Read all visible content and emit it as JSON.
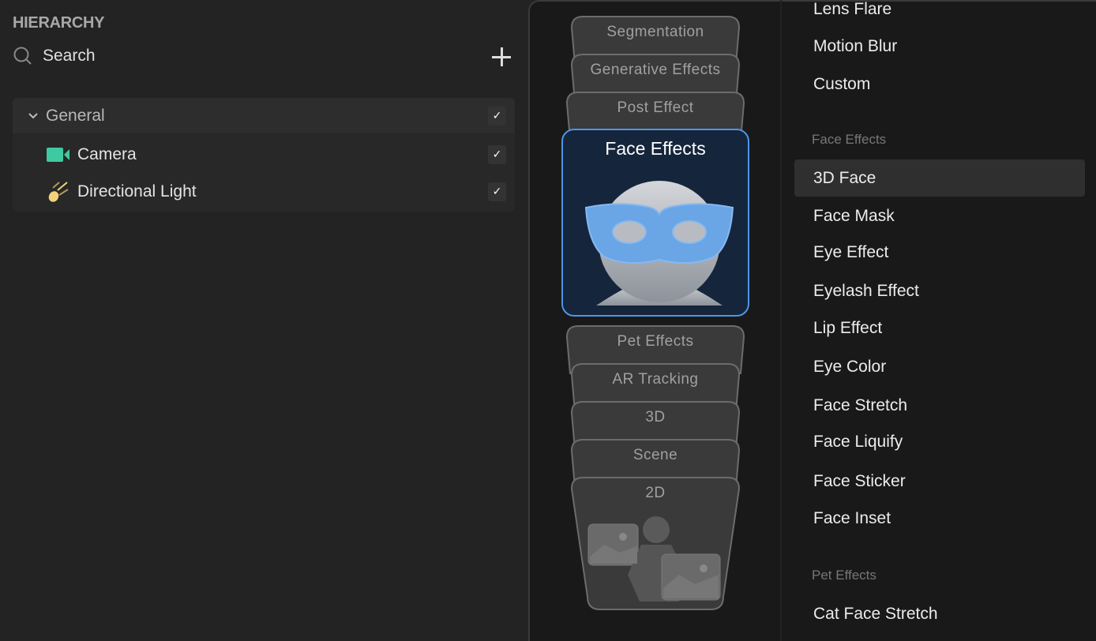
{
  "hierarchy": {
    "title": "HIERARCHY",
    "search_placeholder": "Search",
    "groups": [
      {
        "label": "General",
        "checked": true,
        "items": [
          {
            "label": "Camera",
            "icon": "camera-icon",
            "checked": true
          },
          {
            "label": "Directional Light",
            "icon": "directional-light-icon",
            "checked": true
          }
        ]
      }
    ]
  },
  "categories": {
    "cards": [
      "Segmentation",
      "Generative Effects",
      "Post Effect",
      "Face Effects",
      "Pet Effects",
      "AR Tracking",
      "3D",
      "Scene",
      "2D"
    ],
    "selected": "Face Effects"
  },
  "effects_list": {
    "top_items": [
      "Lens Flare",
      "Motion Blur",
      "Custom"
    ],
    "face_section": "Face Effects",
    "face_items": [
      "3D Face",
      "Face Mask",
      "Eye Effect",
      "Eyelash Effect",
      "Lip Effect",
      "Eye Color",
      "Face Stretch",
      "Face Liquify",
      "Face Sticker",
      "Face Inset"
    ],
    "selected_item": "3D Face",
    "pet_section": "Pet Effects",
    "pet_items": [
      "Cat Face Stretch"
    ]
  },
  "colors": {
    "accent": "#4d95e8",
    "camera": "#3fc9a0",
    "light": "#f3d27a"
  }
}
